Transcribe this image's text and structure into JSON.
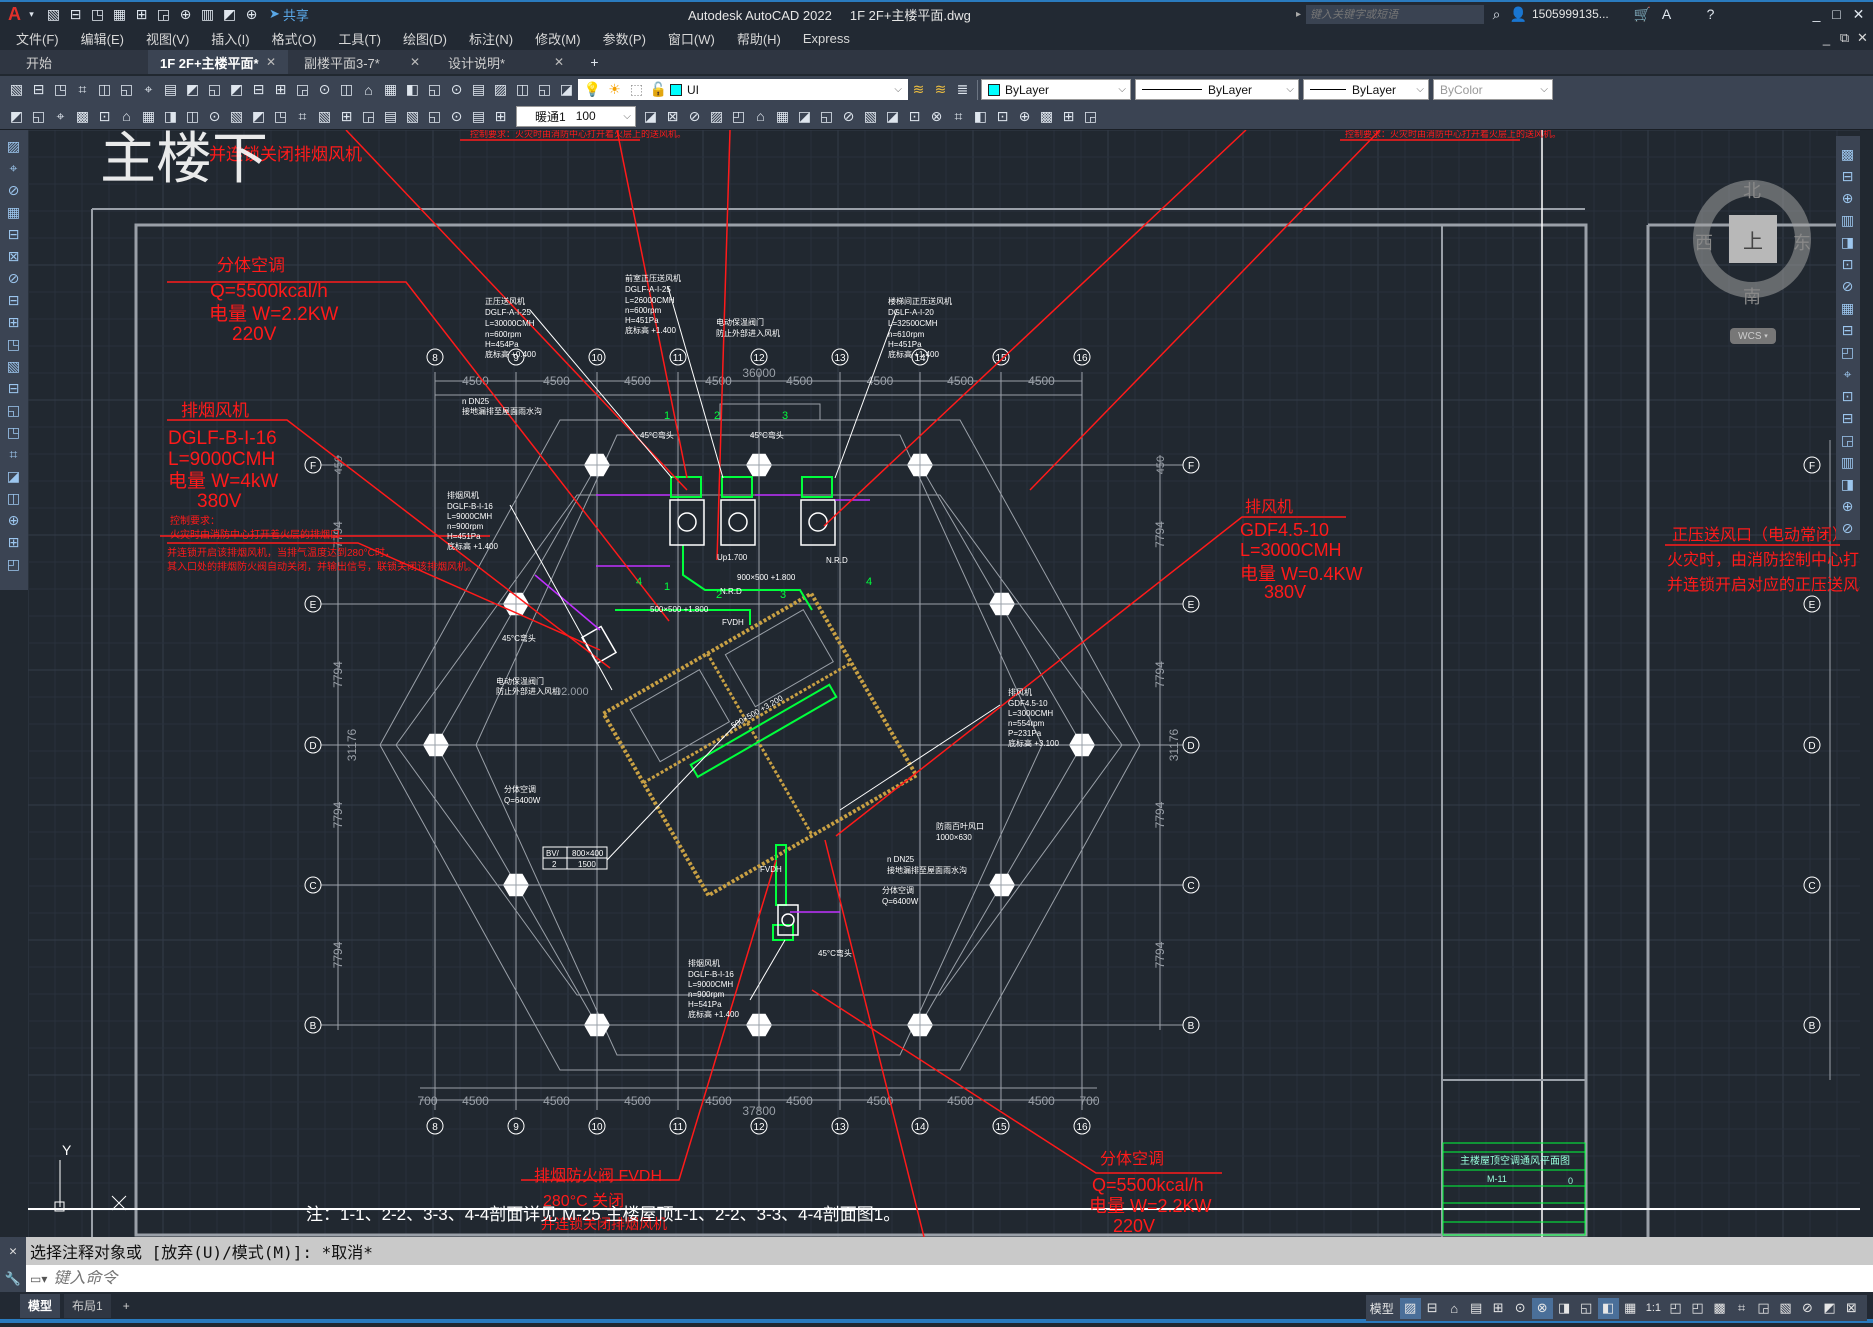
{
  "titlebar": {
    "app_title": "Autodesk AutoCAD 2022",
    "file_name": "1F 2F+主楼平面.dwg",
    "share_label": "共享",
    "search_placeholder": "键入关键字或短语",
    "user_name": "1505999135...",
    "quick_access_icons": [
      "new",
      "open",
      "save",
      "save-as",
      "open-web",
      "save-web",
      "plot",
      "undo",
      "redo",
      "customize"
    ]
  },
  "menu": [
    "文件(F)",
    "编辑(E)",
    "视图(V)",
    "插入(I)",
    "格式(O)",
    "工具(T)",
    "绘图(D)",
    "标注(N)",
    "修改(M)",
    "参数(P)",
    "窗口(W)",
    "帮助(H)",
    "Express"
  ],
  "tabs": [
    {
      "label": "开始",
      "closable": false,
      "active": false
    },
    {
      "label": "1F 2F+主楼平面*",
      "closable": true,
      "active": true
    },
    {
      "label": "副楼平面3-7*",
      "closable": true,
      "active": false
    },
    {
      "label": "设计说明*",
      "closable": true,
      "active": false
    }
  ],
  "toolbar1": {
    "icons_a": [
      "new",
      "open",
      "save",
      "plot",
      "plot-preview",
      "publish",
      "3d-print",
      "cut",
      "copy",
      "paste",
      "match-properties",
      "block-editor",
      "undo",
      "redo",
      "pan",
      "zoom-realtime",
      "zoom-window",
      "zoom-previous",
      "properties",
      "design-center",
      "tool-palettes",
      "sheet-set",
      "markup",
      "quickcalc",
      "help",
      "layer-properties"
    ],
    "layer_icons": [
      "lightbulb",
      "sun",
      "freeze-viewport",
      "unlock"
    ],
    "layer_value": "UI",
    "layer_color": "#00ffff",
    "icons_b": [
      "make-current",
      "layer-previous",
      "layer-states"
    ],
    "color_value": "ByLayer",
    "linetype_value": "ByLayer",
    "lineweight_value": "ByLayer",
    "plotstyle_value": "ByColor"
  },
  "toolbar2": {
    "icons_a": [
      "dim-edit",
      "dim-check",
      "dim-update",
      "linear-dim",
      "aligned-dim",
      "arc-length",
      "ordinate-dim",
      "radius-dim",
      "jogged-dim",
      "diameter-dim",
      "angular-dim",
      "quick-dim",
      "baseline-dim",
      "continue-dim",
      "dim-space",
      "dim-break",
      "tolerance",
      "center-mark",
      "inspect",
      "jogged-linear",
      "dim-text-edit",
      "dim-tedit",
      "dim-override"
    ],
    "dimstyle_value": "暖通1",
    "dimscale_value": "100",
    "icons_b": [
      "dim-style",
      "union",
      "subtract",
      "intersect",
      "extrude-faces",
      "move-faces",
      "offset-faces",
      "delete-faces",
      "rotate-faces",
      "taper-faces",
      "color-faces",
      "copy-faces",
      "imprint",
      "separate",
      "shell",
      "check",
      "clean",
      "slice",
      "interfere",
      "thicken",
      "convert"
    ]
  },
  "left_toolbar_icons": [
    "line",
    "construction-line",
    "polyline",
    "polygon",
    "rectangle",
    "arc",
    "circle",
    "revision-cloud",
    "spline",
    "ellipse",
    "ellipse-arc",
    "insert-block",
    "make-block",
    "point",
    "hatch",
    "gradient",
    "region",
    "table",
    "multiline-text",
    "add-selected"
  ],
  "right_toolbar_icons": [
    "erase",
    "copy",
    "mirror",
    "offset",
    "array",
    "move",
    "rotate",
    "scale",
    "stretch",
    "trim",
    "extend",
    "break-at-point",
    "break",
    "join",
    "chamfer",
    "fillet",
    "blend-curves",
    "explode"
  ],
  "viewcube": {
    "north": "北",
    "south": "南",
    "west": "西",
    "east": "东",
    "face": "上",
    "wcs_label": "WCS"
  },
  "drawing": {
    "grid_columns": [
      "8",
      "9",
      "10",
      "11",
      "12",
      "13",
      "14",
      "15",
      "16"
    ],
    "grid_rows": [
      "F",
      "E",
      "D",
      "C",
      "B"
    ],
    "dims_top": [
      "4500",
      "4500",
      "4500",
      "4500",
      "4500",
      "4500",
      "4500",
      "4500"
    ],
    "dim_top_total": "36000",
    "dims_bottom": [
      "700",
      "4500",
      "4500",
      "4500",
      "4500",
      "4500",
      "4500",
      "4500",
      "4500",
      "700"
    ],
    "dim_bottom_total": "37800",
    "dims_side": [
      "7794",
      "7794",
      "7794",
      "7794"
    ],
    "dim_side_total": "31176",
    "dim_side_small": "450",
    "ucs_y": "Y",
    "top_partial_title": "主楼下",
    "top_red_note": "并连锁关闭排烟风机",
    "top_small_note_1": "控制要求：火灾时由消防中心打开着火层上的送风机。",
    "top_small_note_2": "控制要求：火灾时由消防中心打开着火层上的送风机。",
    "split_ac_1": {
      "title": "分体空调",
      "q": "Q=5500kcal/h",
      "power": "电量 W=2.2KW",
      "voltage": "220V"
    },
    "smoke_fan": {
      "title": "排烟风机",
      "model": "DGLF-B-I-16",
      "flow": "L=9000CMH",
      "power": "电量 W=4kW",
      "voltage": "380V"
    },
    "control_note": [
      "控制要求：",
      "火灾时由消防中心打开着火层的排烟口",
      "并连锁开启该排烟风机，当排气温度达到280°C时，",
      "其入口处的排烟防火阀自动关闭，并输出信号，联锁关闭该排烟风机。"
    ],
    "exhaust_fan": {
      "title": "排风机",
      "model": "GDF4.5-10",
      "flow": "L=3000CMH",
      "power": "电量 W=0.4KW",
      "voltage": "380V"
    },
    "pressure_vent": {
      "title": "正压送风口（电动常闭）",
      "line1": "火灾时，由消防控制中心打开",
      "line2": "并连锁开启对应的正压送风机"
    },
    "fire_damper": {
      "title": "排烟防火阀  FVDH",
      "line1": "280°C  关闭",
      "line2": "并连锁关闭排烟风机"
    },
    "split_ac_2": {
      "title": "分体空调",
      "q": "Q=5500kcal/h",
      "power": "电量 W=2.2KW",
      "voltage": "220V"
    },
    "note": "注：1-1、2-2、3-3、4-4剖面详见 M-25 主楼屋顶1-1、2-2、3-3、4-4剖面图1。",
    "small_labels": {
      "fan1": [
        "正压送风机",
        "DGLF-A-I-25",
        "L=30000CMH",
        "n=600rpm",
        "H=454Pa",
        "底标高 +0.400"
      ],
      "fan2": [
        "前室正压送风机",
        "DGLF-A-I-25",
        "L=26000CMH",
        "n=600rpm",
        "H=451Pa",
        "底标高 +1.400"
      ],
      "fan3": [
        "楼梯间正压送风机",
        "DGLF-A-I-20",
        "L=32500CMH",
        "n=610rpm",
        "H=451Pa",
        "底标高 +1.400"
      ],
      "fan4": [
        "排烟风机",
        "DGLF-B-I-16",
        "L=9000CMH",
        "n=900rpm",
        "H=451Pa",
        "底标高 +1.400"
      ],
      "fan5": [
        "排风机",
        "GDF4.5-10",
        "L=3000CMH",
        "n=554rpm",
        "P=231Pa",
        "底标高 +3.100"
      ],
      "fan6": [
        "排烟风机",
        "DGLF-B-I-16",
        "L=9000CMH",
        "n=900rpm",
        "H=541Pa",
        "底标高 +1.400"
      ],
      "shutter": [
        "电动保温阀门",
        "防止外部进入风机"
      ],
      "drain": [
        "n DN25",
        "接地漏排至屋面雨水沟"
      ],
      "ac": [
        "分体空调",
        "Q=6400W"
      ],
      "louver": [
        "防雨百叶风口",
        "1000×630"
      ],
      "duct1": "500×500  +1.800",
      "duct2": "900×500  +1.800",
      "duct3": "500×500  +3.200",
      "up": "Up1.700",
      "nrd": "N.R.D",
      "fvdh": "FVDH",
      "elbow": "45°C弯头",
      "level": "92.000",
      "bv_table": [
        "BV/",
        "800×400",
        "2",
        "1500"
      ],
      "sections": [
        "1",
        "2",
        "3",
        "1",
        "2",
        "3",
        "4",
        "4"
      ]
    },
    "title_block": {
      "title": "主楼屋顶空调通风平面图",
      "drawing_no": "M-11",
      "revision": "0"
    },
    "colors": {
      "red": "#ff1a1a",
      "white": "#ffffff",
      "green": "#00ff3c",
      "magenta": "#c030ff",
      "wall": "#c8a044",
      "grid": "#9aa0a8"
    }
  },
  "command": {
    "history": "选择注释对象或 [放弃(U)/模式(M)]: *取消*",
    "placeholder": "键入命令"
  },
  "layout_tabs": [
    "模型",
    "布局1",
    "+"
  ],
  "status": {
    "model_label": "模型",
    "scale": "1:1",
    "icons": [
      "grid",
      "snap",
      "ortho",
      "polar",
      "isodraft",
      "osnap-tracking",
      "osnap",
      "lineweight",
      "transparency",
      "annotation-visibility",
      "auto-scale",
      "annotation-scale",
      "workspace",
      "annotation-monitor",
      "units",
      "quick-properties",
      "hardware-acceleration",
      "isolate",
      "clean-screen",
      "customize"
    ]
  }
}
